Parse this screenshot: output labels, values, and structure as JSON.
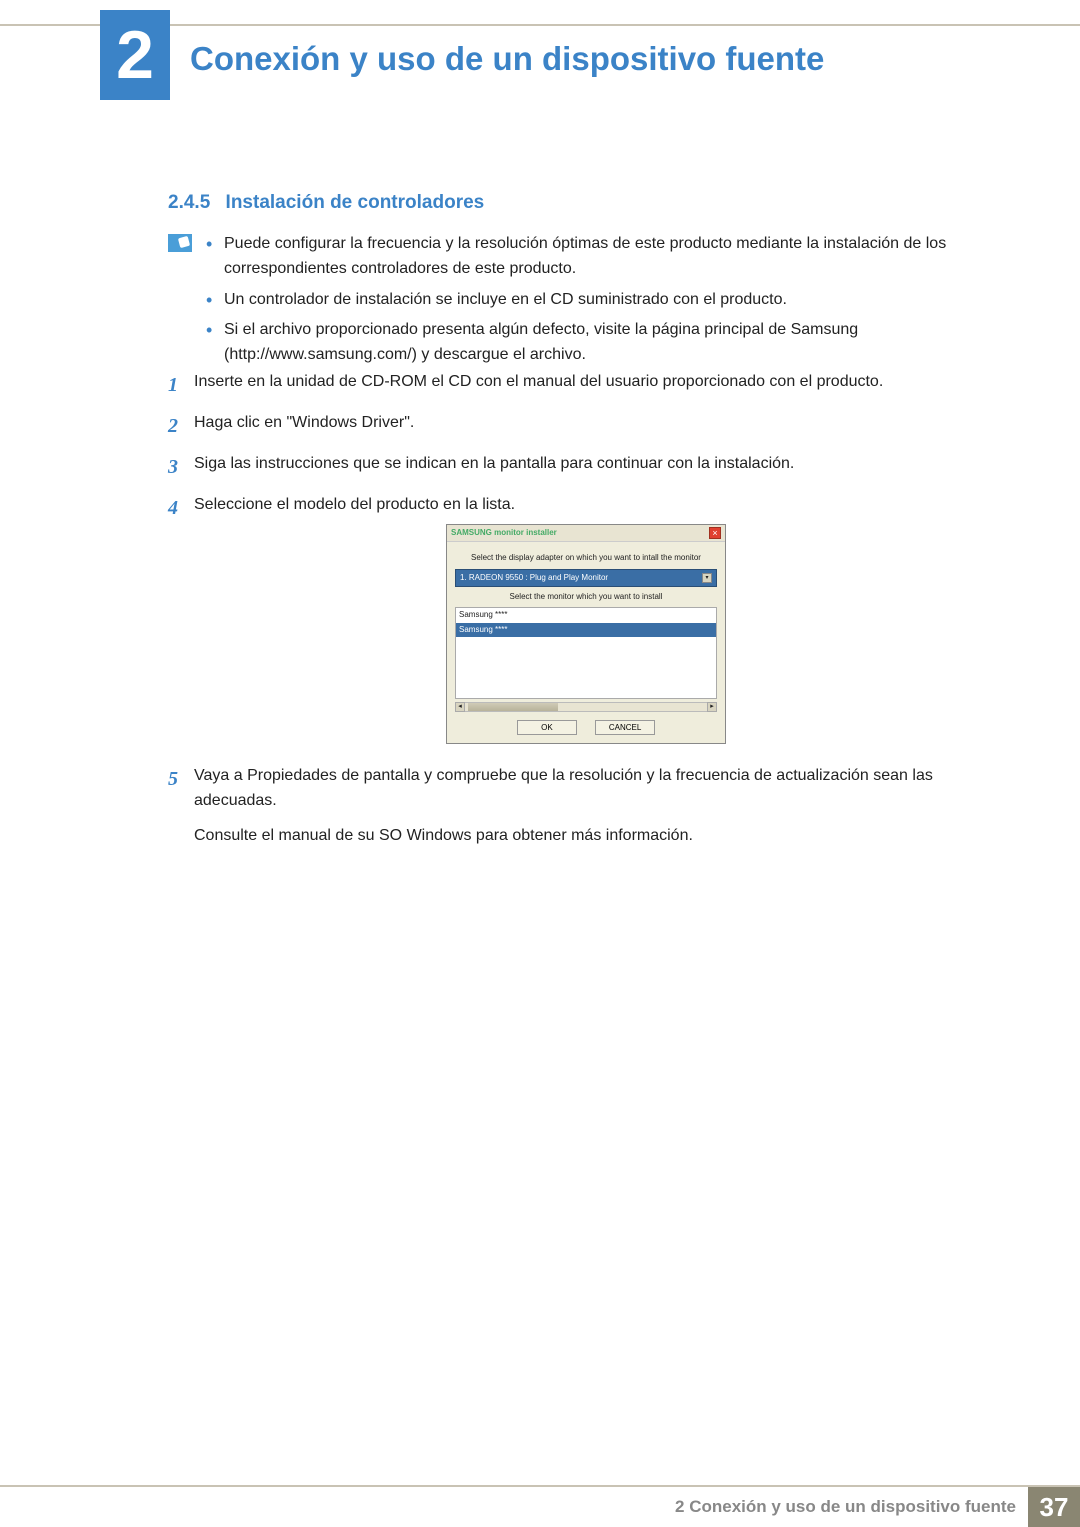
{
  "chapter": {
    "number": "2",
    "title": "Conexión y uso de un dispositivo fuente"
  },
  "section": {
    "number": "2.4.5",
    "title": "Instalación de controladores"
  },
  "info_bullets": [
    "Puede configurar la frecuencia y la resolución óptimas de este producto mediante la instalación de los correspondientes controladores de este producto.",
    "Un controlador de instalación se incluye en el CD suministrado con el producto.",
    "Si el archivo proporcionado presenta algún defecto, visite la página principal de Samsung (http://www.samsung.com/) y descargue el archivo."
  ],
  "steps": [
    {
      "n": "1",
      "text": "Inserte en la unidad de CD-ROM el CD con el manual del usuario proporcionado con el producto."
    },
    {
      "n": "2",
      "text": "Haga clic en \"Windows Driver\"."
    },
    {
      "n": "3",
      "text": "Siga las instrucciones que se indican en la pantalla para continuar con la instalación."
    },
    {
      "n": "4",
      "text": "Seleccione el modelo del producto en la lista."
    },
    {
      "n": "5",
      "text": "Vaya a Propiedades de pantalla y compruebe que la resolución y la frecuencia de actualización sean las adecuadas.",
      "extra": "Consulte el manual de su SO Windows para obtener más información."
    }
  ],
  "dialog": {
    "title": "SAMSUNG monitor installer",
    "label1": "Select the display adapter on which you want to intall the monitor",
    "adapter": "1. RADEON 9550 : Plug and Play Monitor",
    "label2": "Select the monitor which you want to install",
    "list": [
      "Samsung ****",
      "Samsung ****"
    ],
    "ok": "OK",
    "cancel": "CANCEL"
  },
  "footer": {
    "title": "2 Conexión y uso de un dispositivo fuente",
    "page": "37"
  }
}
